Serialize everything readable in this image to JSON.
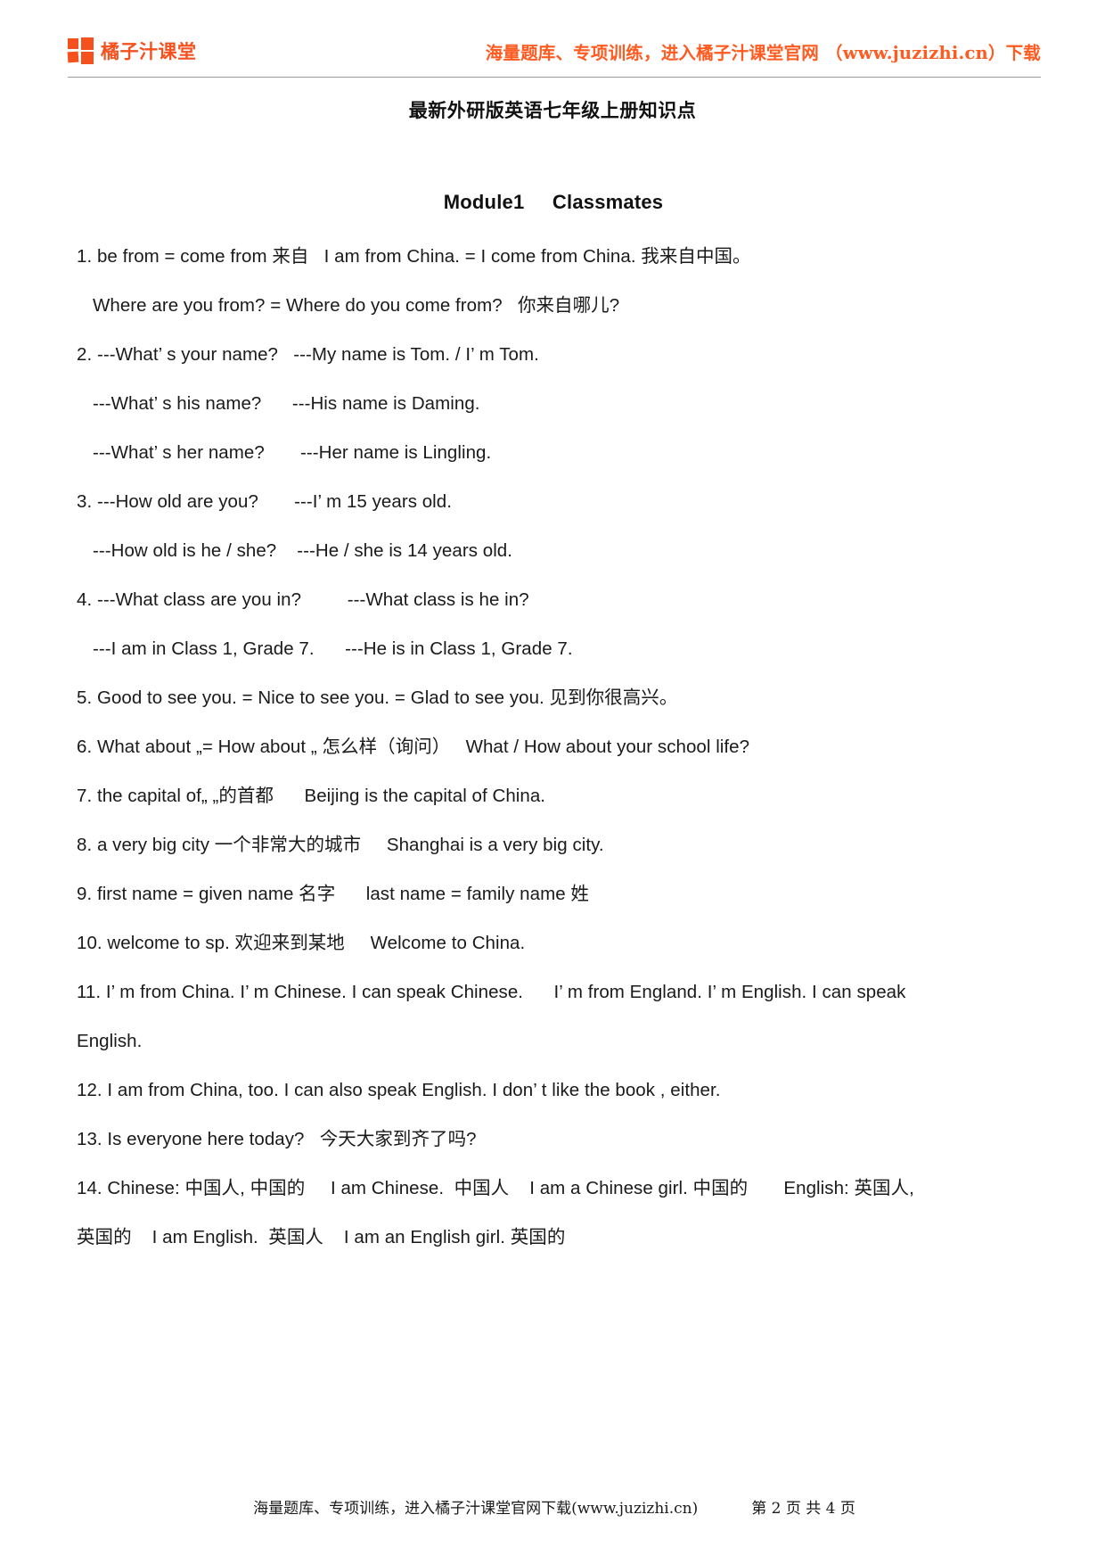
{
  "header": {
    "logo_icon": "four-squares-logo-icon",
    "brand_name": "橘子汁课堂",
    "promo_text": "海量题库、专项训练，进入橘子汁课堂官网 （www.juzizhi.cn）下载",
    "brand_color": "#f4511e"
  },
  "document": {
    "title": "最新外研版英语七年级上册知识点",
    "module_heading": "Module1     Classmates"
  },
  "notes": [
    {
      "id": "note-1a",
      "text": "1. be from = come from 来自   I am from China. = I come from China. 我来自中国。",
      "indent": false
    },
    {
      "id": "note-1b",
      "text": "Where are you from? = Where do you come from?   你来自哪儿?",
      "indent": true
    },
    {
      "id": "note-2a",
      "text": "2. ---What’ s your name?   ---My name is Tom. / I’ m Tom.",
      "indent": false
    },
    {
      "id": "note-2b",
      "text": "---What’ s his name?      ---His name is Daming.",
      "indent": true
    },
    {
      "id": "note-2c",
      "text": "---What’ s her name?       ---Her name is Lingling.",
      "indent": true
    },
    {
      "id": "note-3a",
      "text": "3. ---How old are you?       ---I’ m 15 years old.",
      "indent": false
    },
    {
      "id": "note-3b",
      "text": "---How old is he / she?    ---He / she is 14 years old.",
      "indent": true
    },
    {
      "id": "note-4a",
      "text": "4. ---What class are you in?         ---What class is he in?",
      "indent": false
    },
    {
      "id": "note-4b",
      "text": "---I am in Class 1, Grade 7.      ---He is in Class 1, Grade 7.",
      "indent": true
    },
    {
      "id": "note-5",
      "text": "5. Good to see you. = Nice to see you. = Glad to see you. 见到你很高兴。",
      "indent": false
    },
    {
      "id": "note-6",
      "text": "6. What about „= How about „ 怎么样（询问）   What / How about your school life?",
      "indent": false
    },
    {
      "id": "note-7",
      "text": "7. the capital of„ „的首都      Beijing is the capital of China.",
      "indent": false
    },
    {
      "id": "note-8",
      "text": "8. a very big city 一个非常大的城市     Shanghai is a very big city.",
      "indent": false
    },
    {
      "id": "note-9",
      "text": "9. first name = given name 名字      last name = family name 姓",
      "indent": false
    },
    {
      "id": "note-10",
      "text": "10. welcome to sp. 欢迎来到某地     Welcome to China.",
      "indent": false
    },
    {
      "id": "note-11a",
      "text": "11. I’ m from China. I’ m Chinese. I can speak Chinese.      I’ m from England. I’ m English. I can speak",
      "indent": false
    },
    {
      "id": "note-11b",
      "text": "English.",
      "indent": false
    },
    {
      "id": "note-12",
      "text": "12. I am from China, too. I can also speak English. I don’ t like the book , either.",
      "indent": false
    },
    {
      "id": "note-13",
      "text": "13. Is everyone here today?   今天大家到齐了吗?",
      "indent": false
    },
    {
      "id": "note-14a",
      "text": "14. Chinese: 中国人, 中国的     I am Chinese.  中国人    I am a Chinese girl. 中国的       English: 英国人,",
      "indent": false
    },
    {
      "id": "note-14b",
      "text": "英国的    I am English.  英国人    I am an English girl. 英国的",
      "indent": false
    }
  ],
  "footer": {
    "note": "海量题库、专项训练，进入橘子汁课堂官网下载(www.juzizhi.cn)",
    "page_label": "第 2 页 共 4 页"
  }
}
